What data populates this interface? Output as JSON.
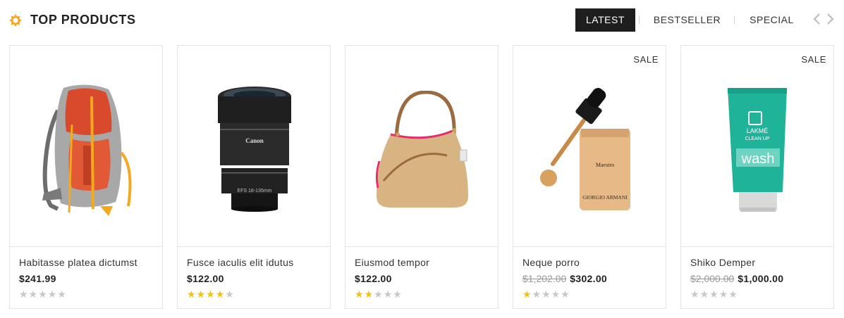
{
  "header": {
    "title": "TOP PRODUCTS",
    "title_icon": "badge-star-icon",
    "tabs": [
      "LATEST",
      "BESTSELLER",
      "SPECIAL"
    ],
    "active_tab": "LATEST",
    "nav_icons": [
      "chevron-left-icon",
      "chevron-right-icon"
    ]
  },
  "colors": {
    "accent": "#f5a623",
    "tab_active_bg": "#1e1e1e",
    "star_on": "#f4c20d",
    "star_off": "#c8c8c8"
  },
  "products": [
    {
      "name": "Habitasse platea dictumst",
      "price": "$241.99",
      "old_price": "",
      "badge": "",
      "rating": 0,
      "rating_max": 5
    },
    {
      "name": "Fusce iaculis elit idutus",
      "price": "$122.00",
      "old_price": "",
      "badge": "",
      "rating": 4,
      "rating_max": 5
    },
    {
      "name": "Eiusmod tempor",
      "price": "$122.00",
      "old_price": "",
      "badge": "",
      "rating": 2,
      "rating_max": 5
    },
    {
      "name": "Neque porro",
      "price": "$302.00",
      "old_price": "$1,202.00",
      "badge": "SALE",
      "rating": 1,
      "rating_max": 5
    },
    {
      "name": "Shiko Demper",
      "price": "$1,000.00",
      "old_price": "$2,000.00",
      "badge": "SALE",
      "rating": 0,
      "rating_max": 5
    }
  ],
  "product_images": {
    "camera_brand": "Canon",
    "camera_lens": "EFS 18-135mm",
    "foundation_brand": "Maestro",
    "foundation_maker": "GIORGIO ARMANI",
    "cream_brand": "LAKMÉ",
    "cream_line": "CLEAN UP",
    "cream_word": "wash"
  }
}
